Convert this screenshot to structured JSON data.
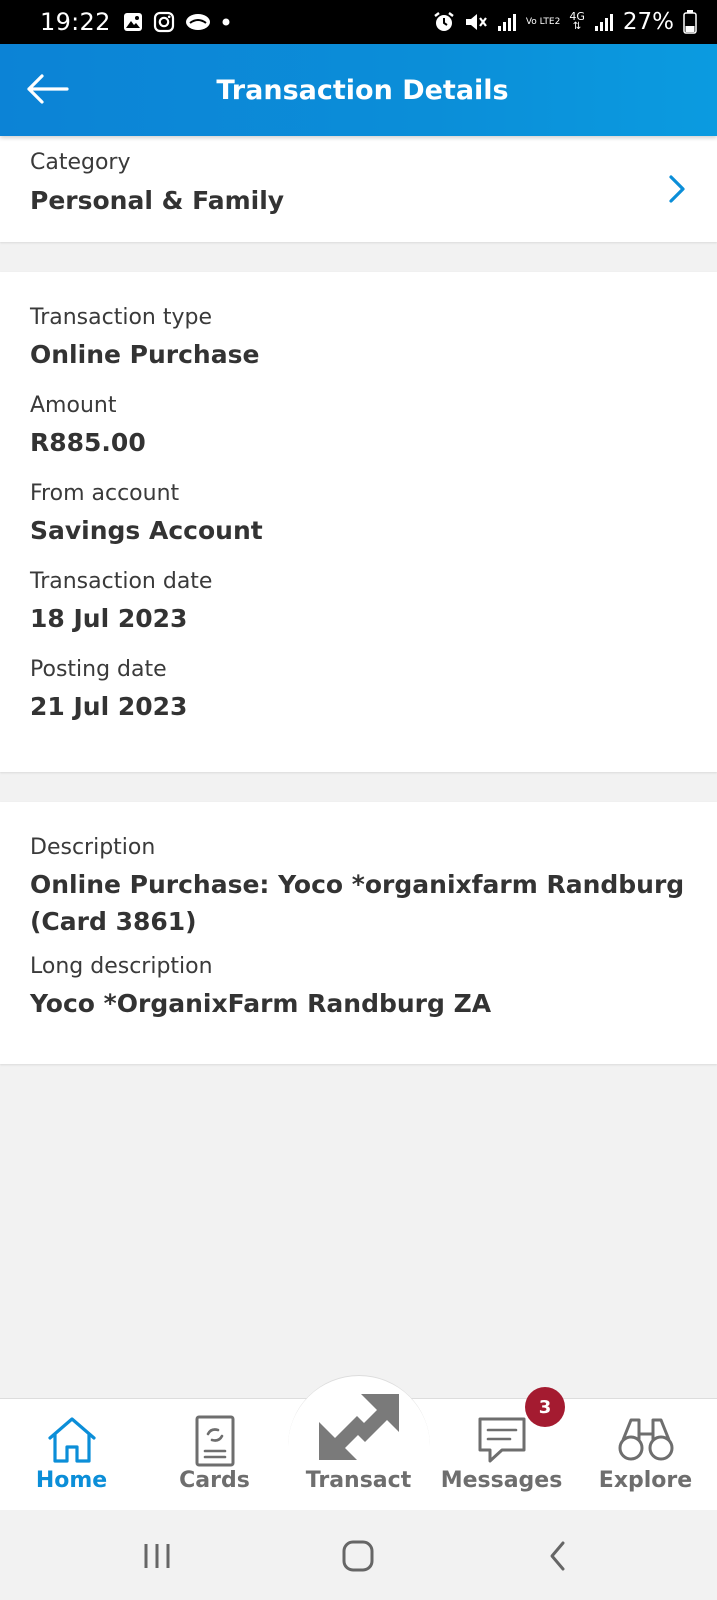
{
  "status_bar": {
    "time": "19:22",
    "battery": "27%",
    "left_icons": [
      "gallery-icon",
      "instagram-icon",
      "cloud-icon",
      "dot-icon"
    ],
    "right_icons": [
      "alarm-icon",
      "mute-icon",
      "signal-icon",
      "volte-icon",
      "4g-icon",
      "signal-icon",
      "battery-icon"
    ],
    "volte_text": "Vo LTE2",
    "net_text": "4G"
  },
  "header": {
    "title": "Transaction Details",
    "back_icon": "arrow-left-icon"
  },
  "category": {
    "label": "Category",
    "value": "Personal & Family"
  },
  "details": {
    "transaction_type_label": "Transaction type",
    "transaction_type_value": "Online Purchase",
    "amount_label": "Amount",
    "amount_value": "R885.00",
    "from_account_label": "From account",
    "from_account_value": "Savings Account",
    "transaction_date_label": "Transaction date",
    "transaction_date_value": "18 Jul 2023",
    "posting_date_label": "Posting date",
    "posting_date_value": "21 Jul 2023"
  },
  "description": {
    "description_label": "Description",
    "description_line1": "Online Purchase: Yoco *organixfarm Randburg",
    "description_line2": "(Card 3861)",
    "long_description_label": "Long description",
    "long_description_value": "Yoco *OrganixFarm Randburg ZA"
  },
  "bottom_nav": {
    "items": [
      {
        "label": "Home",
        "icon": "home-icon",
        "active": true
      },
      {
        "label": "Cards",
        "icon": "card-icon",
        "active": false
      },
      {
        "label": "Transact",
        "icon": "transfer-arrows-icon",
        "active": false
      },
      {
        "label": "Messages",
        "icon": "message-icon",
        "active": false
      },
      {
        "label": "Explore",
        "icon": "binoculars-icon",
        "active": false
      }
    ],
    "messages_badge": "3"
  },
  "colors": {
    "accent": "#0b8ed8",
    "badge": "#a41b30",
    "nav_inactive": "#6e6e6e",
    "background": "#f2f2f2"
  }
}
